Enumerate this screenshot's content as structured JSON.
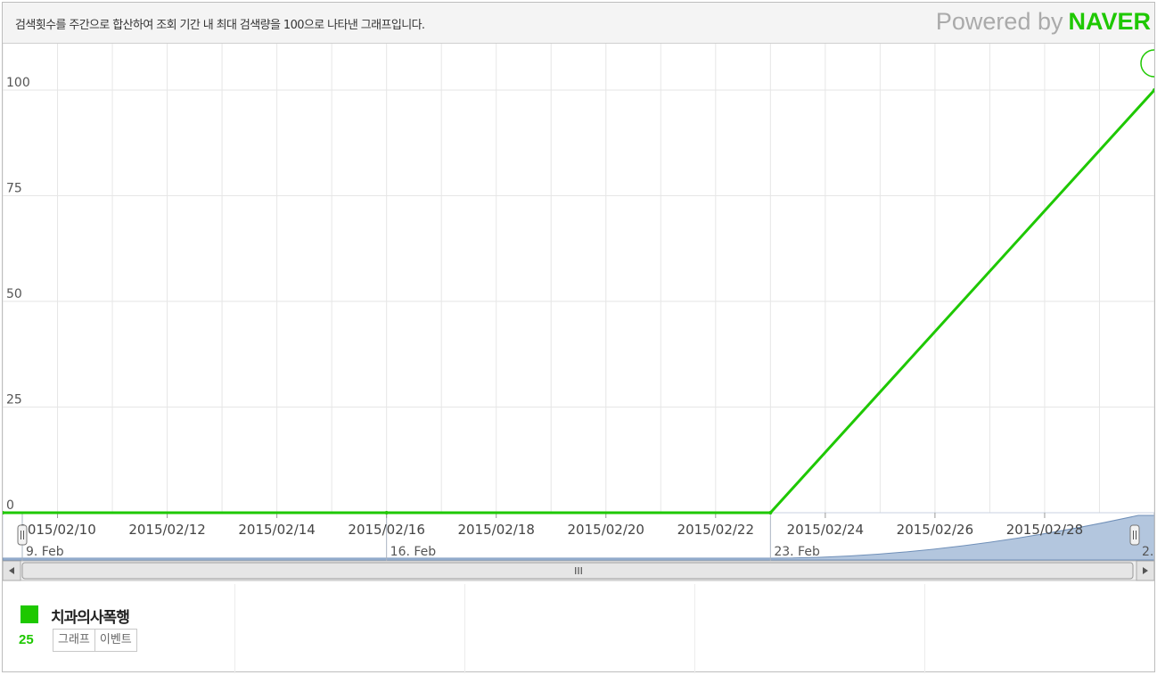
{
  "header": {
    "description": "검색횟수를 주간으로 합산하여 조회 기간 내 최대 검색량을 100으로 나타낸 그래프입니다.",
    "powered_by": "Powered by",
    "brand": "NAVER"
  },
  "colors": {
    "series": "#1ec800",
    "navigator_fill": "#b3c6de",
    "navigator_line": "#6f8fb8",
    "grid": "#e6e6e6",
    "brand": "#1ec800"
  },
  "chart_data": {
    "type": "line",
    "title": "",
    "xlabel": "",
    "ylabel": "",
    "ylim": [
      0,
      100
    ],
    "x_range": [
      "2015-02-09",
      "2015-03-02"
    ],
    "yticks": [
      0,
      25,
      50,
      75,
      100
    ],
    "ytick_labels": [
      "0",
      "25",
      "50",
      "75",
      "100"
    ],
    "xtick_dates": [
      "2015-02-10",
      "2015-02-12",
      "2015-02-14",
      "2015-02-16",
      "2015-02-18",
      "2015-02-20",
      "2015-02-22",
      "2015-02-24",
      "2015-02-26",
      "2015-02-28"
    ],
    "xtick_labels": [
      "2015/02/10",
      "2015/02/12",
      "2015/02/14",
      "2015/02/16",
      "2015/02/18",
      "2015/02/20",
      "2015/02/22",
      "2015/02/24",
      "2015/02/26",
      "2015/02/28"
    ],
    "grid": true,
    "series": [
      {
        "name": "치과의사폭행",
        "x": [
          "2015-02-09",
          "2015-02-16",
          "2015-02-23",
          "2015-03-02"
        ],
        "values": [
          0,
          0,
          0,
          100
        ]
      }
    ],
    "navigator": {
      "labels": [
        {
          "date": "2015-02-09",
          "text": "9. Feb"
        },
        {
          "date": "2015-02-16",
          "text": "16. Feb"
        },
        {
          "date": "2015-02-23",
          "text": "23. Feb"
        },
        {
          "date": "2015-03-02",
          "text": "2."
        }
      ],
      "scrollbar_grip": "III"
    }
  },
  "legend": {
    "series_name": "치과의사폭행",
    "value": "25",
    "graph_button": "그래프",
    "event_button": "이벤트"
  }
}
